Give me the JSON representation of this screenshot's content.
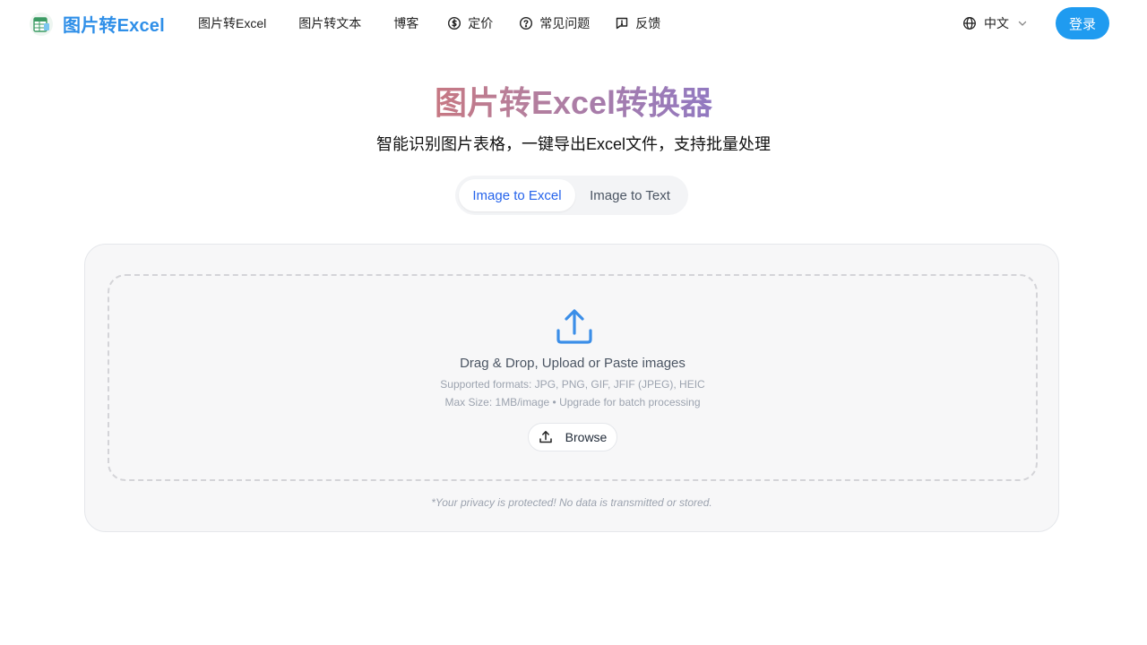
{
  "header": {
    "logo_text": "图片转Excel",
    "nav": [
      {
        "label": "图片转Excel",
        "icon": ""
      },
      {
        "label": "图片转文本",
        "icon": ""
      },
      {
        "label": "博客",
        "icon": ""
      },
      {
        "label": "定价",
        "icon": "dollar-circle-icon"
      },
      {
        "label": "常见问题",
        "icon": "help-circle-icon"
      },
      {
        "label": "反馈",
        "icon": "message-square-icon"
      }
    ],
    "language": "中文",
    "login_label": "登录"
  },
  "hero": {
    "title": "图片转Excel转换器",
    "subtitle": "智能识别图片表格，一键导出Excel文件，支持批量处理"
  },
  "tabs": [
    {
      "label": "Image to Excel",
      "active": true
    },
    {
      "label": "Image to Text",
      "active": false
    }
  ],
  "upload": {
    "main_text": "Drag & Drop, Upload or Paste images",
    "formats_text": "Supported formats: JPG, PNG, GIF, JFIF (JPEG), HEIC",
    "size_text": "Max Size: 1MB/image • Upgrade for batch processing",
    "browse_label": "Browse",
    "privacy_text": "*Your privacy is protected! No data is transmitted or stored."
  },
  "colors": {
    "accent": "#1f9bf0",
    "logo_text": "#2f8fe8",
    "title_gradient_start": "#f97316",
    "title_gradient_end": "#3d7ff0",
    "tab_active_text": "#2563eb"
  }
}
